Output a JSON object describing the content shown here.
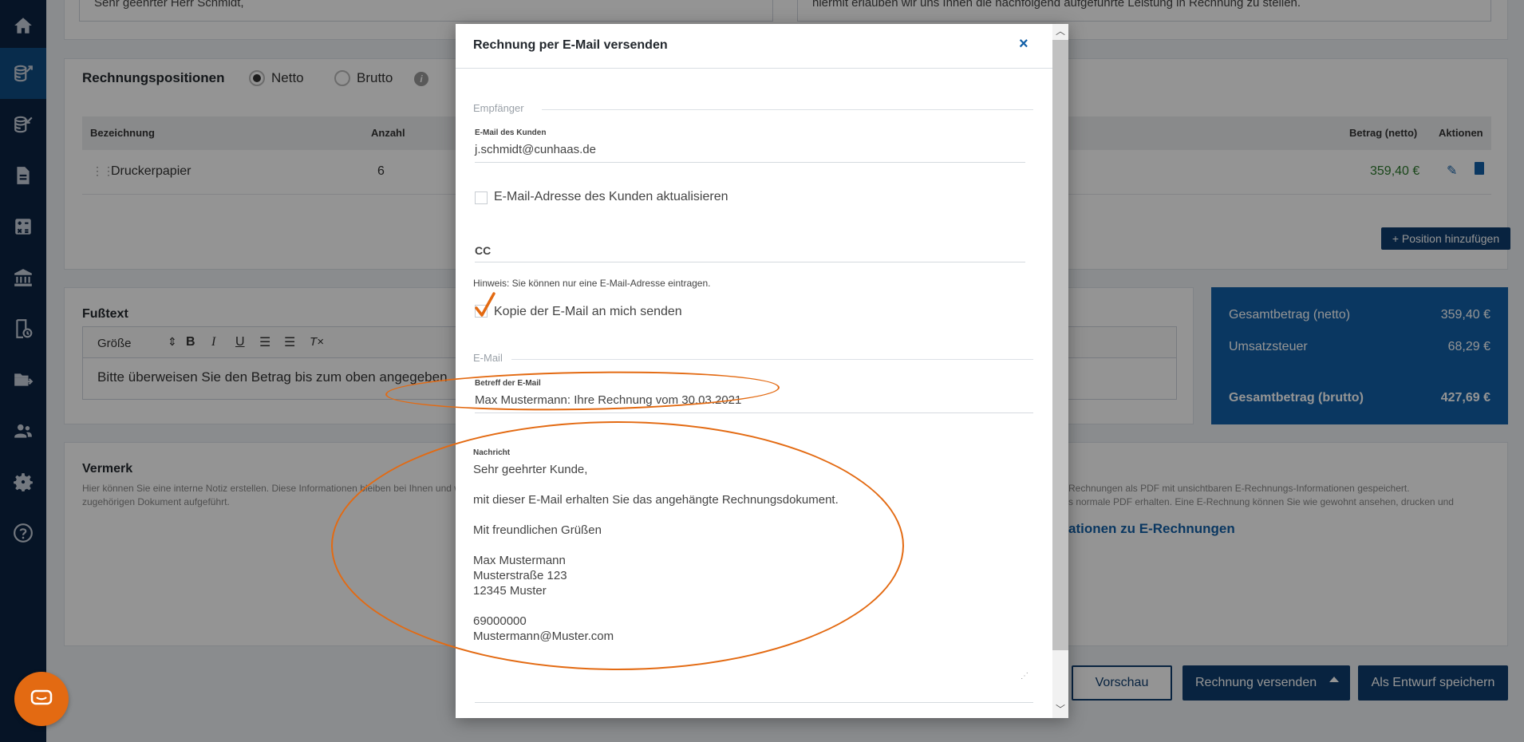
{
  "sidebar": {
    "items": [
      {
        "icon": "home-icon"
      },
      {
        "icon": "invoice-out-icon",
        "active": true
      },
      {
        "icon": "invoice-in-icon"
      },
      {
        "icon": "document-icon"
      },
      {
        "icon": "calculator-icon"
      },
      {
        "icon": "bank-icon"
      },
      {
        "icon": "receipt-icon"
      },
      {
        "icon": "export-icon"
      },
      {
        "icon": "contacts-icon"
      },
      {
        "icon": "settings-icon"
      },
      {
        "icon": "help-icon"
      }
    ]
  },
  "background": {
    "intro_left": "Sehr geehrter Herr Schmidt,",
    "intro_right": "hiermit erlauben wir uns Ihnen die nachfolgend aufgeführte Leistung in Rechnung zu stellen.",
    "positions": {
      "title": "Rechnungspositionen",
      "netto": "Netto",
      "brutto": "Brutto",
      "columns": {
        "bezeichnung": "Bezeichnung",
        "anzahl": "Anzahl",
        "betrag": "Betrag (netto)",
        "aktionen": "Aktionen"
      },
      "row": {
        "name": "Druckerpapier",
        "qty": "6",
        "amount": "359,40 €"
      },
      "add_button": "+ Position hinzufügen"
    },
    "footer_text": {
      "title": "Fußtext",
      "size_select": "Größe",
      "content": "Bitte überweisen Sie den Betrag bis zum oben angegeben"
    },
    "totals": {
      "net_label": "Gesamtbetrag (netto)",
      "net_value": "359,40 €",
      "tax_label": "Umsatzsteuer",
      "tax_value": "68,29 €",
      "gross_label": "Gesamtbetrag (brutto)",
      "gross_value": "427,69 €"
    },
    "note": {
      "title": "Vermerk",
      "desc1": "Hier können Sie eine interne Notiz erstellen. Diese Informationen bleiben bei Ihnen und werden nicht im",
      "desc2": "zugehörigen Dokument aufgeführt."
    },
    "erechnung": {
      "line1": "Rechnungen als PDF mit unsichtbaren E-Rechnungs-Informationen gespeichert.",
      "line2": "s normale PDF erhalten. Eine E-Rechnung können Sie wie gewohnt ansehen, drucken und",
      "link": "ationen zu E-Rechnungen"
    },
    "buttons": {
      "preview": "Vorschau",
      "send": "Rechnung versenden",
      "draft": "Als Entwurf speichern"
    }
  },
  "modal": {
    "title": "Rechnung per E-Mail versenden",
    "close": "×",
    "recipient_section": "Empfänger",
    "customer_email_label": "E-Mail des Kunden",
    "customer_email": "j.schmidt@cunhaas.de",
    "update_email_label": "E-Mail-Adresse des Kunden aktualisieren",
    "cc_label": "CC",
    "hint": "Hinweis: Sie können nur eine E-Mail-Adresse eintragen.",
    "copy_label": "Kopie der E-Mail an mich senden",
    "copy_checked": true,
    "email_section": "E-Mail",
    "subject_label": "Betreff der E-Mail",
    "subject": "Max Mustermann: Ihre Rechnung vom 30.03.2021",
    "message_label": "Nachricht",
    "message": {
      "greeting": "Sehr geehrter Kunde,",
      "body": "mit dieser E-Mail erhalten Sie das angehängte Rechnungsdokument.",
      "closing": "Mit freundlichen Grüßen",
      "name": "Max Mustermann",
      "street": "Musterstraße 123",
      "city": "12345 Muster",
      "phone": "69000000",
      "email": "Mustermann@Muster.com"
    }
  },
  "colors": {
    "sidebar": "#0c2342",
    "accent": "#1260a8",
    "annotation": "#e36a12"
  }
}
